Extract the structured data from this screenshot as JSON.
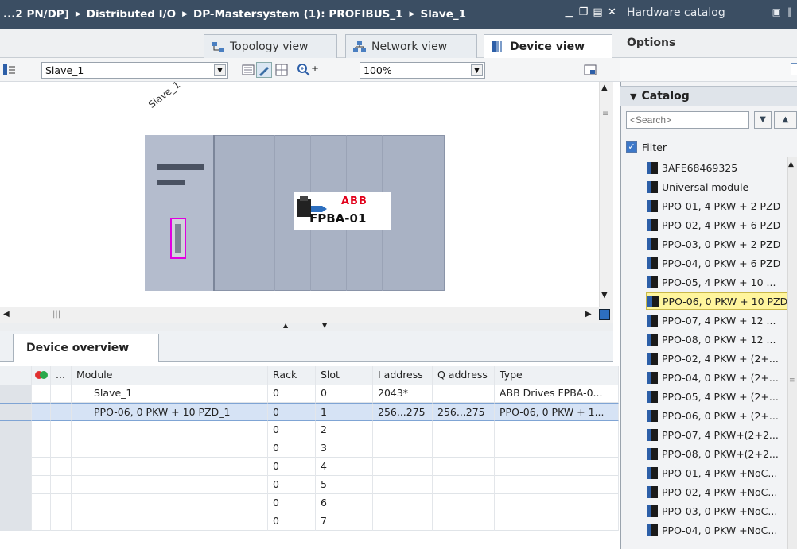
{
  "titlebar": {
    "crumbs": [
      "...2 PN/DP]",
      "Distributed I/O",
      "DP-Mastersystem (1): PROFIBUS_1",
      "Slave_1"
    ]
  },
  "view_tabs": {
    "topology": "Topology view",
    "network": "Network view",
    "device": "Device view"
  },
  "toolbar": {
    "device_select": "Slave_1",
    "zoom": "100%"
  },
  "canvas": {
    "device_label": "Slave_1",
    "module_brand": "ABB",
    "module_name": "FPBA-01"
  },
  "overview": {
    "tab": "Device overview",
    "columns": {
      "ellipsis": "...",
      "module": "Module",
      "rack": "Rack",
      "slot": "Slot",
      "i_address": "I address",
      "q_address": "Q address",
      "type": "Type"
    },
    "rows": [
      {
        "module": "Slave_1",
        "rack": "0",
        "slot": "0",
        "i_address": "2043*",
        "q_address": "",
        "type": "ABB Drives FPBA-0..."
      },
      {
        "module": "PPO-06, 0 PKW + 10 PZD_1",
        "rack": "0",
        "slot": "1",
        "i_address": "256...275",
        "q_address": "256...275",
        "type": "PPO-06, 0 PKW + 1..."
      },
      {
        "module": "",
        "rack": "0",
        "slot": "2",
        "i_address": "",
        "q_address": "",
        "type": ""
      },
      {
        "module": "",
        "rack": "0",
        "slot": "3",
        "i_address": "",
        "q_address": "",
        "type": ""
      },
      {
        "module": "",
        "rack": "0",
        "slot": "4",
        "i_address": "",
        "q_address": "",
        "type": ""
      },
      {
        "module": "",
        "rack": "0",
        "slot": "5",
        "i_address": "",
        "q_address": "",
        "type": ""
      },
      {
        "module": "",
        "rack": "0",
        "slot": "6",
        "i_address": "",
        "q_address": "",
        "type": ""
      },
      {
        "module": "",
        "rack": "0",
        "slot": "7",
        "i_address": "",
        "q_address": "",
        "type": ""
      }
    ]
  },
  "catalog_pane": {
    "title": "Hardware catalog",
    "options": "Options",
    "catalog": "Catalog",
    "search_placeholder": "<Search>",
    "filter": "Filter",
    "items": [
      "3AFE68469325",
      "Universal module",
      "PPO-01, 4 PKW + 2 PZD",
      "PPO-02, 4 PKW + 6 PZD",
      "PPO-03, 0 PKW + 2 PZD",
      "PPO-04, 0 PKW + 6 PZD",
      "PPO-05, 4 PKW + 10 ...",
      "PPO-06, 0 PKW + 10 PZD",
      "PPO-07, 4 PKW + 12 ...",
      "PPO-08, 0 PKW + 12 ...",
      "PPO-02, 4 PKW + (2+...",
      "PPO-04, 0 PKW + (2+...",
      "PPO-05, 4 PKW + (2+...",
      "PPO-06, 0 PKW + (2+...",
      "PPO-07, 4 PKW+(2+2...",
      "PPO-08, 0 PKW+(2+2...",
      "PPO-01, 4 PKW +NoC...",
      "PPO-02, 4 PKW +NoC...",
      "PPO-03, 0 PKW +NoC...",
      "PPO-04, 0 PKW +NoC..."
    ],
    "highlighted_index": 7
  },
  "colors": {
    "titlebar": "#3b4e63",
    "selection": "#d6e3f5",
    "highlight": "#fff59d",
    "port_outline": "#e000e0"
  }
}
